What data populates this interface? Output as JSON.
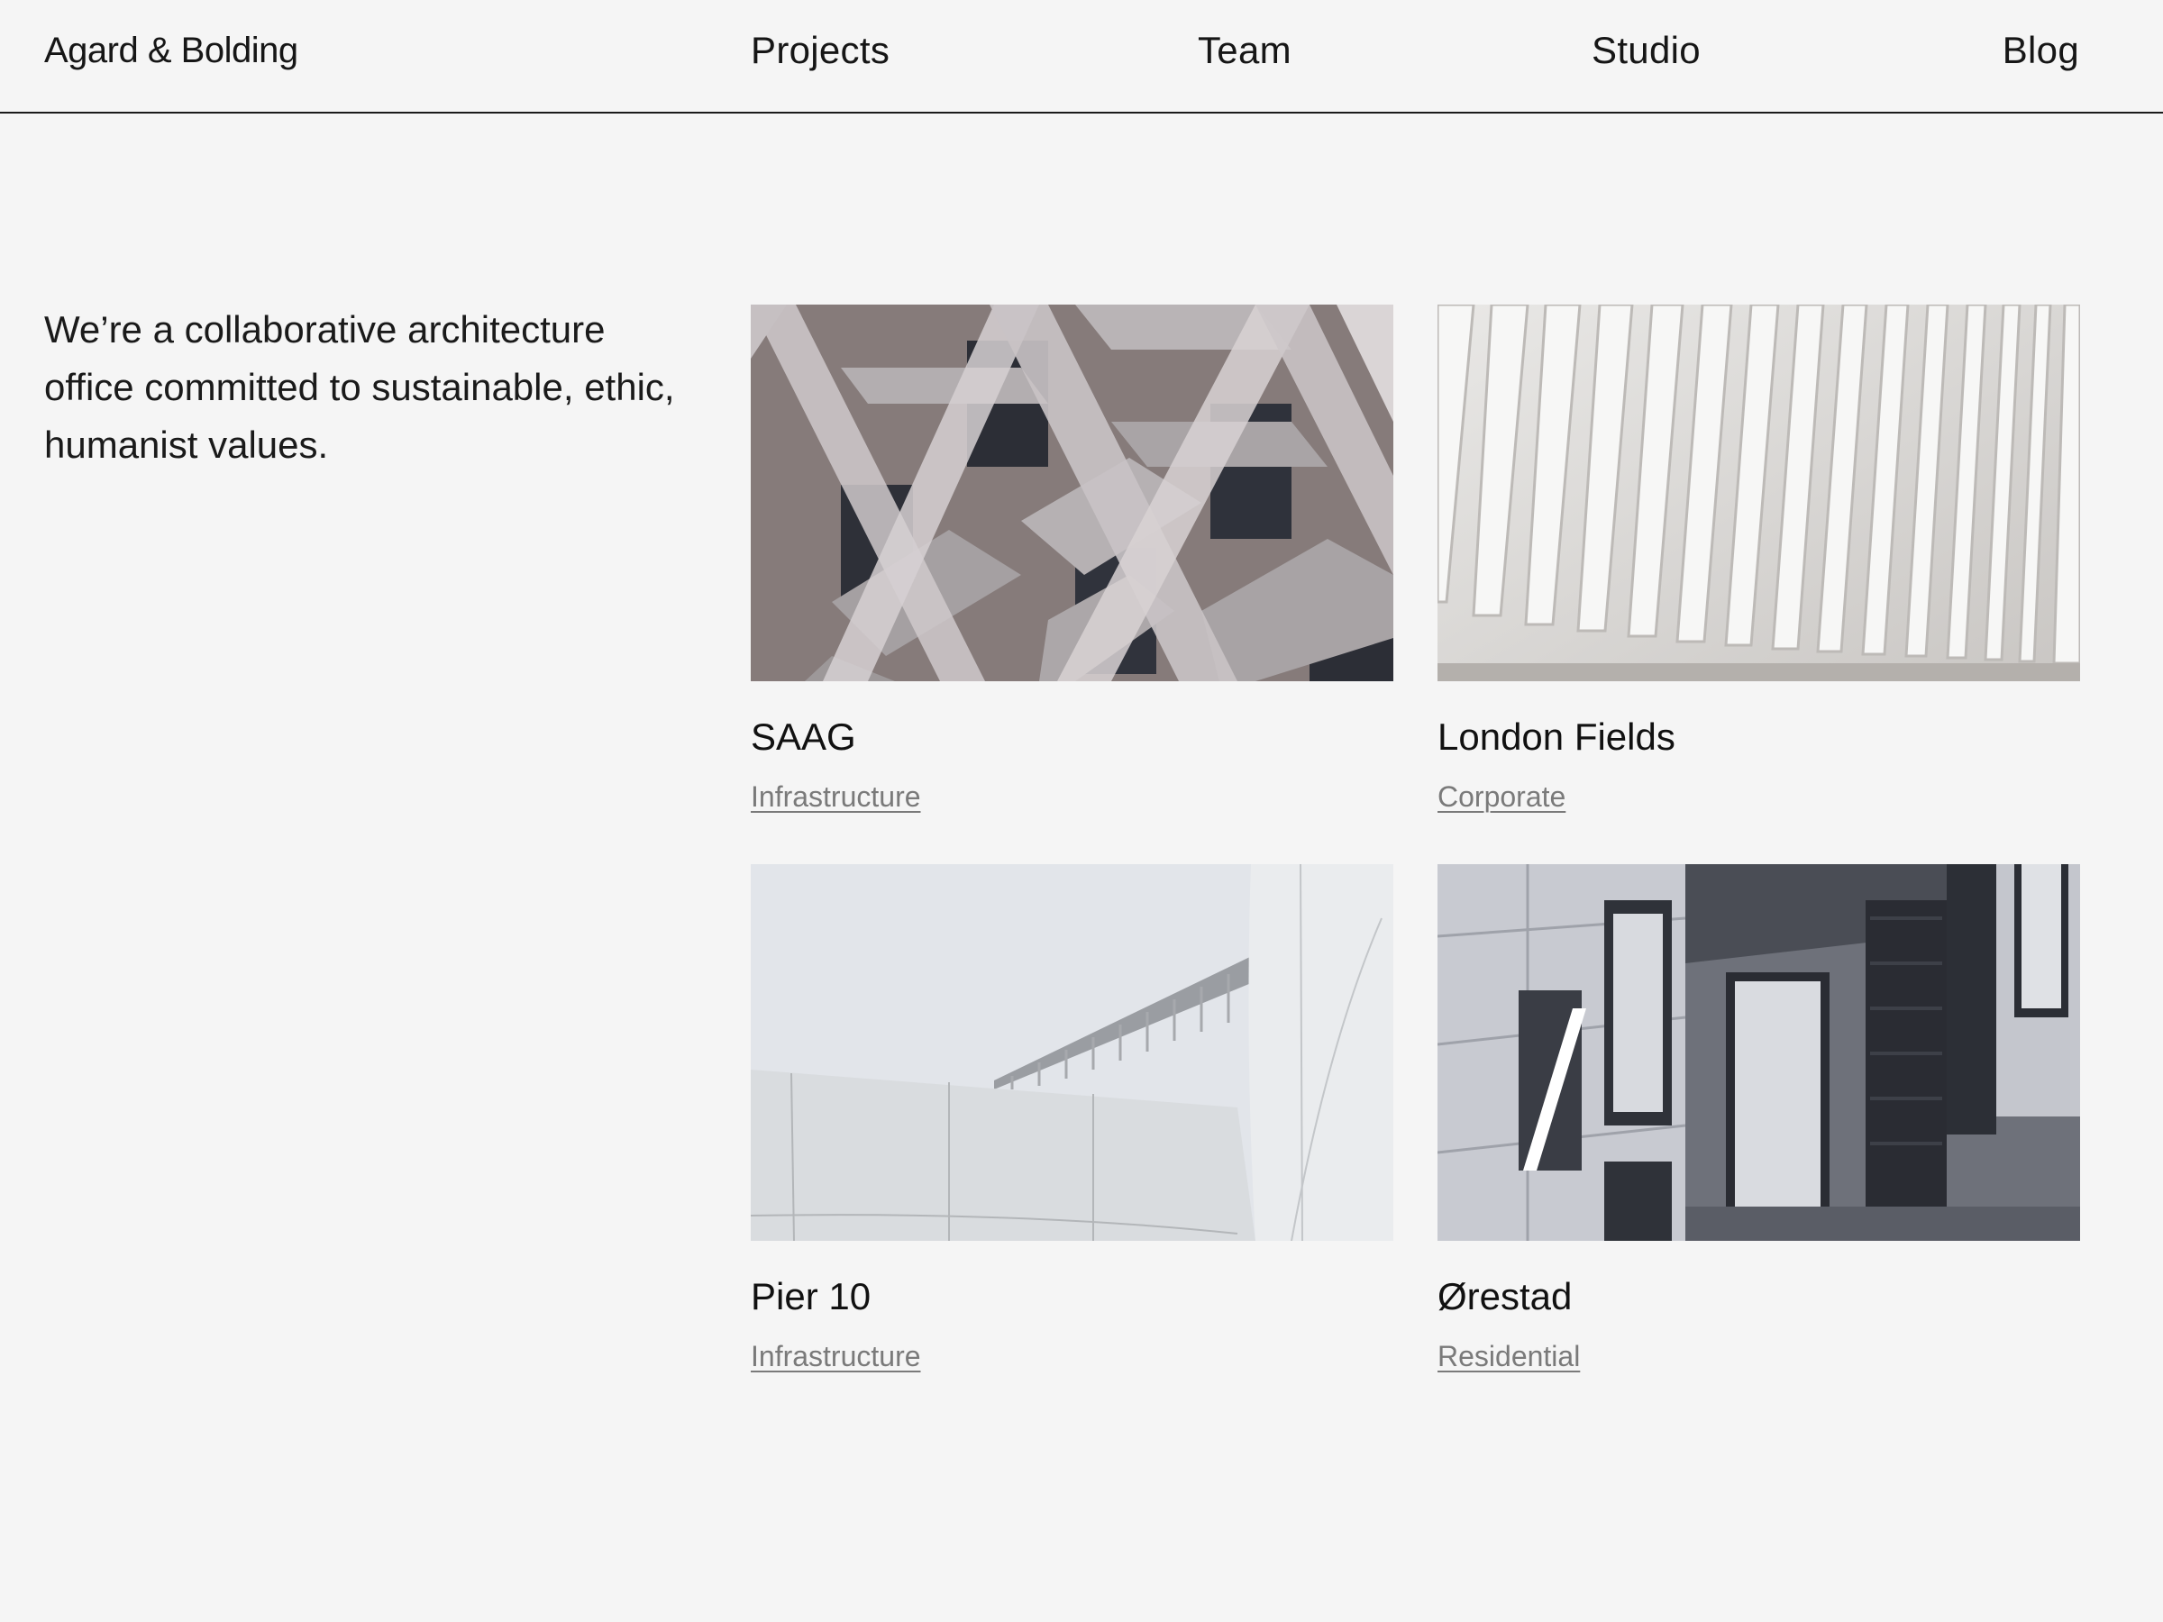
{
  "header": {
    "brand": "Agard & Bolding",
    "nav": [
      "Projects",
      "Team",
      "Studio",
      "Blog"
    ]
  },
  "intro": {
    "text": "We’re a collaborative architecture office committed to sustainable, ethic, humanist values."
  },
  "projects": [
    {
      "title": "SAAG",
      "category": "Infrastructure"
    },
    {
      "title": "London Fields",
      "category": "Corporate"
    },
    {
      "title": "Pier 10",
      "category": "Infrastructure"
    },
    {
      "title": "Ørestad",
      "category": "Residential"
    }
  ],
  "colors": {
    "background": "#f5f5f5",
    "text": "#111111",
    "muted": "#7a7a7a",
    "rule": "#1a1a1a"
  }
}
